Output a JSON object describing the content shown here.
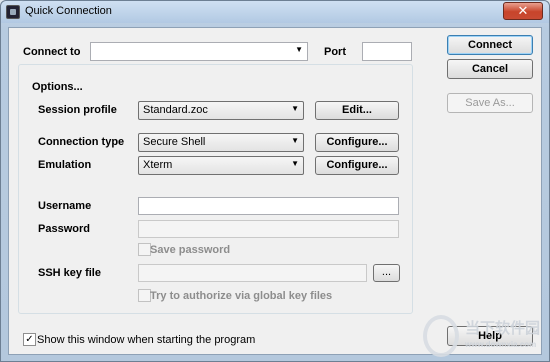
{
  "window": {
    "title": "Quick Connection",
    "close_glyph": "✕"
  },
  "connect_to": {
    "label": "Connect to",
    "value": "",
    "port_label": "Port",
    "port_value": ""
  },
  "actions": {
    "connect": "Connect",
    "cancel": "Cancel",
    "save_as": "Save As...",
    "help": "Help"
  },
  "options": {
    "title": "Options...",
    "session_profile": {
      "label": "Session profile",
      "value": "Standard.zoc",
      "button": "Edit..."
    },
    "connection_type": {
      "label": "Connection type",
      "value": "Secure Shell",
      "button": "Configure..."
    },
    "emulation": {
      "label": "Emulation",
      "value": "Xterm",
      "button": "Configure..."
    },
    "username": {
      "label": "Username",
      "value": ""
    },
    "password": {
      "label": "Password",
      "value": ""
    },
    "save_password": {
      "label": "Save password",
      "checked": false
    },
    "ssh_key_file": {
      "label": "SSH key file",
      "value": "",
      "browse": "..."
    },
    "global_key": {
      "label": "Try to authorize via global key files",
      "checked": false
    }
  },
  "startup": {
    "label": "Show this window when starting the program",
    "checked": true,
    "check_glyph": "✓"
  },
  "watermark": {
    "text": "当下软件园",
    "url": "www.downxia.com"
  }
}
